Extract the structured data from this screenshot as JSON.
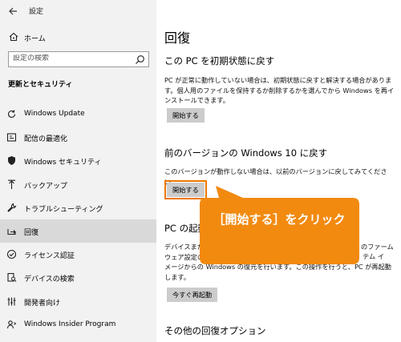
{
  "window": {
    "title": "設定"
  },
  "sidebar": {
    "home_label": "ホーム",
    "search_placeholder": "設定の検索",
    "section_title": "更新とセキュリティ",
    "items": [
      {
        "label": "Windows Update",
        "icon": "refresh-icon"
      },
      {
        "label": "配信の最適化",
        "icon": "delivery-optimization-icon"
      },
      {
        "label": "Windows セキュリティ",
        "icon": "shield-icon"
      },
      {
        "label": "バックアップ",
        "icon": "backup-arrow-icon"
      },
      {
        "label": "トラブルシューティング",
        "icon": "wrench-icon"
      },
      {
        "label": "回復",
        "icon": "recovery-icon",
        "selected": true
      },
      {
        "label": "ライセンス認証",
        "icon": "check-circle-icon"
      },
      {
        "label": "デバイスの検索",
        "icon": "find-device-icon"
      },
      {
        "label": "開発者向け",
        "icon": "developer-icon"
      },
      {
        "label": "Windows Insider Program",
        "icon": "insider-icon"
      }
    ]
  },
  "main": {
    "title": "回復",
    "reset": {
      "heading": "この PC を初期状態に戻す",
      "description": "PC が正常に動作していない場合は、初期状態に戻すと解決する場合があります。個人用のファイルを保持するか削除するかを選んでから Windows を再インストールできます。",
      "button": "開始する"
    },
    "goback": {
      "heading": "前のバージョンの Windows 10 に戻す",
      "description": "このバージョンが動作しない場合は、以前のバージョンに戻してみてください。",
      "button": "開始する"
    },
    "advanced": {
      "heading": "PC の起動を",
      "description": "デバイスまたは\nウェア設定の変\nメージからの Windows の復元を行います。この操作を行うと、PC が再起動\nします。",
      "desc_right_1": "のファーム",
      "desc_right_2": "テム イ",
      "button": "今すぐ再起動"
    },
    "other": {
      "heading": "その他の回復オプション"
    }
  },
  "callout": {
    "text": "［開始する］をクリック",
    "color": "#f28a10"
  }
}
